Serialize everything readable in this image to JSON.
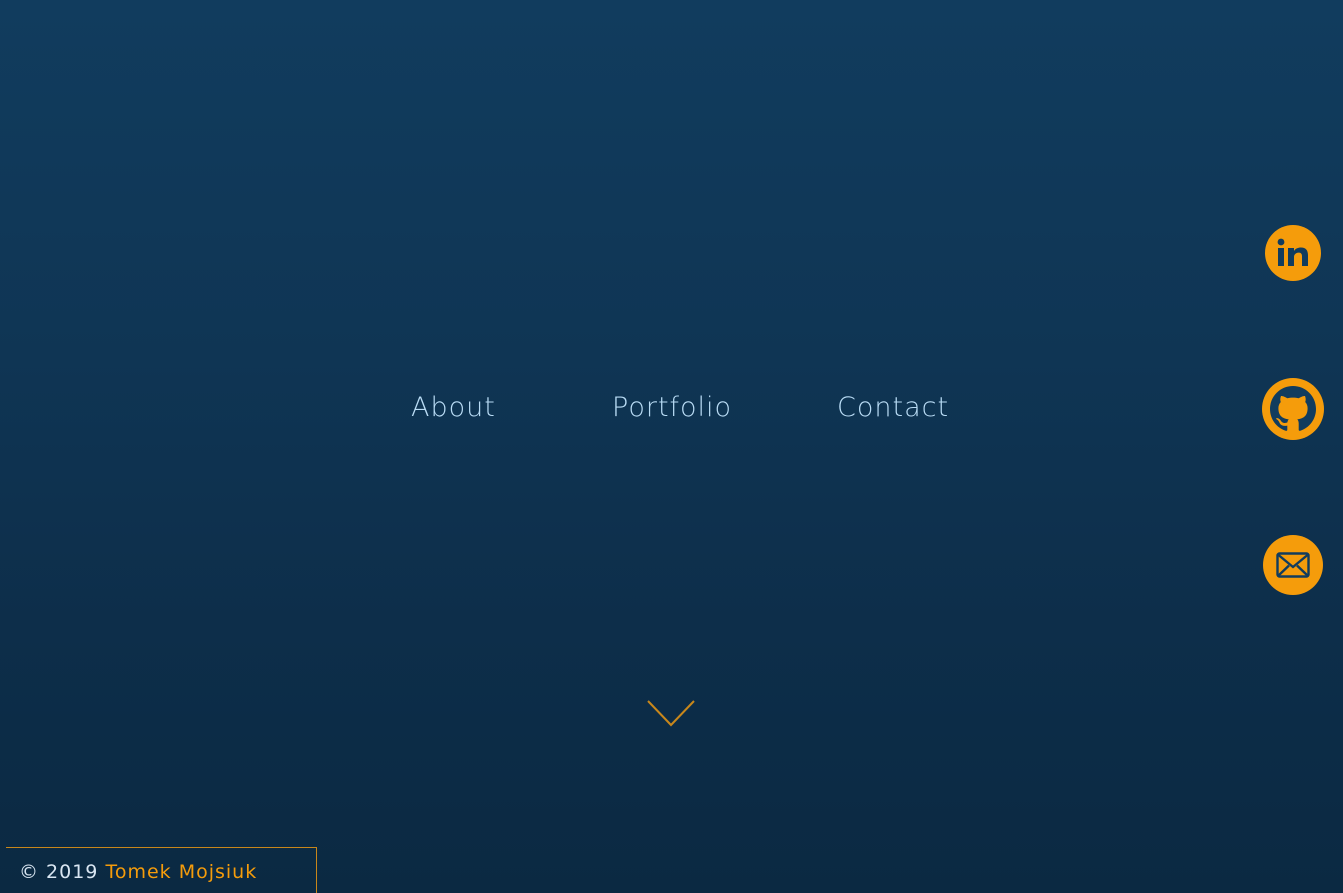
{
  "nav": {
    "items": [
      {
        "label": "About"
      },
      {
        "label": "Portfolio"
      },
      {
        "label": "Contact"
      }
    ]
  },
  "social": [
    {
      "icon": "linkedin-icon"
    },
    {
      "icon": "github-icon"
    },
    {
      "icon": "email-icon"
    }
  ],
  "scroll": {
    "icon": "chevron-down-icon"
  },
  "footer": {
    "copyright": "© 2019",
    "name": "Tomek Mojsiuk"
  },
  "colors": {
    "accent": "#f59c0b",
    "background_top": "#113c5e",
    "background_bottom": "#0b2942",
    "nav_text": "#b9dcf5"
  }
}
